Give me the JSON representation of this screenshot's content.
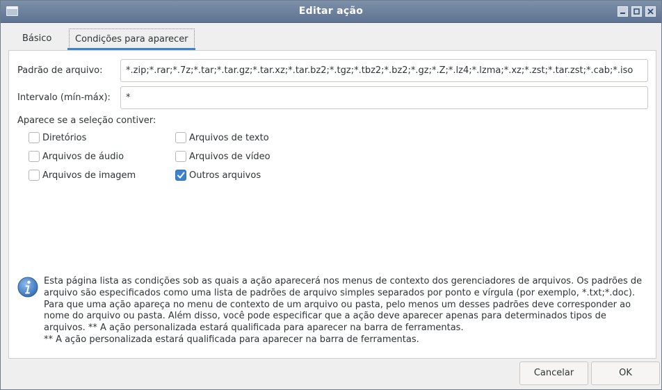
{
  "window": {
    "title": "Editar ação"
  },
  "tabs": [
    {
      "label": "Básico",
      "active": false
    },
    {
      "label": "Condições para aparecer",
      "active": true
    }
  ],
  "form": {
    "pattern_label": "Padrão de arquivo:",
    "pattern_value": "*.zip;*.rar;*.7z;*.tar;*.tar.gz;*.tar.xz;*.tar.bz2;*.tgz;*.tbz2;*.bz2;*.gz;*.Z;*.lz4;*.lzma;*.xz;*.zst;*.tar.zst;*.cab;*.iso",
    "range_label": "Intervalo (mín-máx):",
    "range_value": "*",
    "selection_label": "Aparece se a seleção contiver:"
  },
  "checkboxes": [
    {
      "label": "Diretórios",
      "checked": false
    },
    {
      "label": "Arquivos de texto",
      "checked": false
    },
    {
      "label": "Arquivos de áudio",
      "checked": false
    },
    {
      "label": "Arquivos de vídeo",
      "checked": false
    },
    {
      "label": "Arquivos de imagem",
      "checked": false
    },
    {
      "label": "Outros arquivos",
      "checked": true
    }
  ],
  "info": {
    "icon": "info-icon",
    "text": "Esta página lista as condições sob as quais a ação aparecerá nos menus de contexto dos gerenciadores de arquivos. Os padrões de arquivo são especificados como uma lista de padrões de arquivo simples separados por ponto e vírgula (por exemplo, *.txt;*.doc). Para que uma ação apareça no menu de contexto de um arquivo ou pasta, pelo menos um desses padrões deve corresponder ao nome do arquivo ou pasta. Além disso, você pode especificar que a ação deve aparecer apenas para determinados tipos de arquivos. ** A ação personalizada estará qualificada para aparecer na barra de ferramentas.\n** A ação personalizada estará qualificada para aparecer na barra de ferramentas."
  },
  "buttons": {
    "cancel": "Cancelar",
    "ok": "OK"
  },
  "colors": {
    "accent": "#3d82cc",
    "titlebar": "#6b7f9c"
  }
}
